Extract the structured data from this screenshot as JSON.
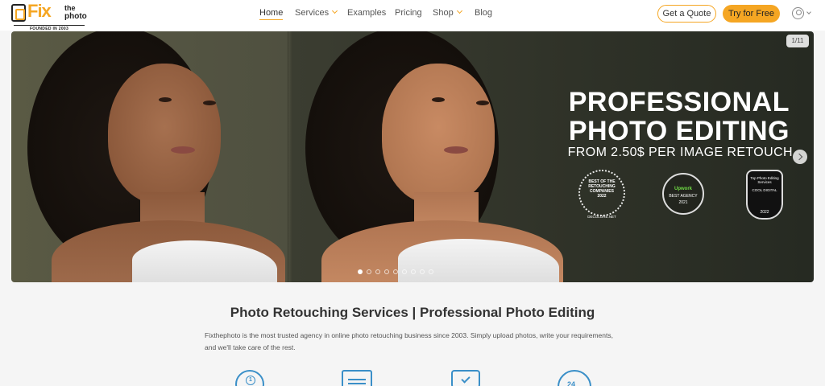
{
  "header": {
    "logo": {
      "fix": "Fix",
      "the": "the",
      "photo": "photo",
      "founded": "FOUNDED IN 2003"
    },
    "nav": [
      {
        "label": "Home",
        "active": true
      },
      {
        "label": "Services",
        "has_dropdown": true
      },
      {
        "label": "Examples"
      },
      {
        "label": "Pricing"
      },
      {
        "label": "Shop",
        "has_dropdown": true
      },
      {
        "label": "Blog"
      }
    ],
    "quote_button": "Get a Quote",
    "try_button": "Try for Free",
    "account_icon": "user-circle-icon"
  },
  "hero": {
    "slide_counter": "1/11",
    "headline_line1": "PROFESSIONAL",
    "headline_line2": "PHOTO EDITING",
    "subline": "FROM 2.50$ PER IMAGE RETOUCH",
    "badges": {
      "decolore": {
        "title": "BEST OF THE RETOUCHING COMPANIES",
        "year": "2022",
        "source": "DECOLORE.NET"
      },
      "upwork": {
        "brand": "Upwork",
        "title": "BEST AGENCY",
        "year": "2021"
      },
      "cool_digital": {
        "title": "Top Photo Editing Services",
        "brand": "COOL DIGITAL",
        "year": "2022"
      }
    },
    "dots_total": 9,
    "active_dot": 0
  },
  "main": {
    "title": "Photo Retouching Services | Professional Photo Editing",
    "intro": "Fixthephoto is the most trusted agency in online photo retouching business since 2003. Simply upload photos, write your requirements, and we'll take care of the rest.",
    "feature_icons": [
      "medal-icon",
      "document-icon",
      "shield-check-icon",
      "clock-24h-icon"
    ],
    "medal_number": "1",
    "clock_label": "24"
  },
  "colors": {
    "accent": "#f5a623",
    "icon_blue": "#3a8fc8"
  }
}
